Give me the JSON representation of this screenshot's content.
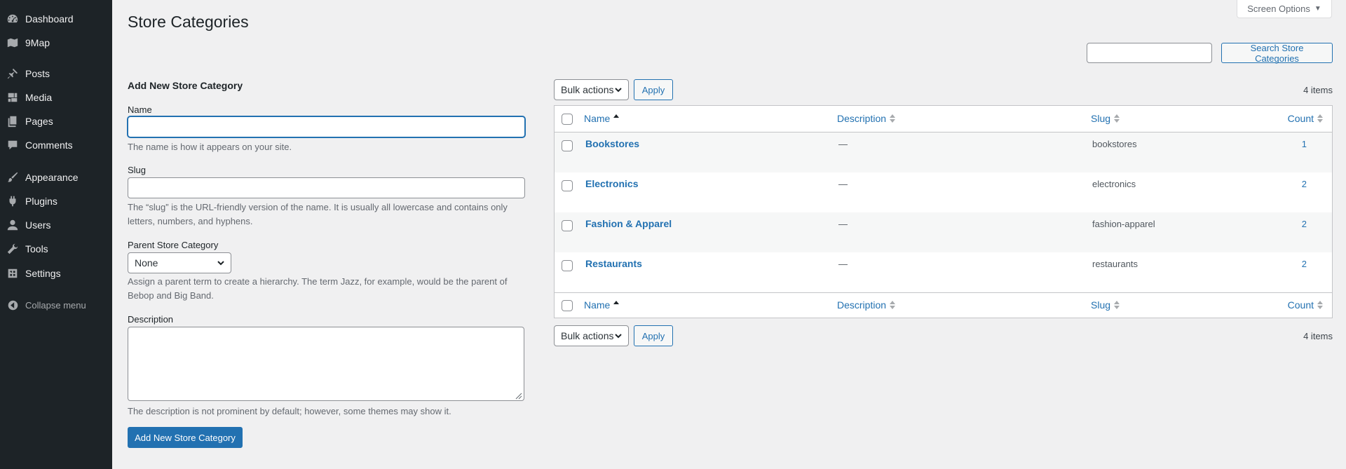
{
  "sidebar": {
    "items": [
      {
        "label": "Dashboard",
        "icon": "dashboard-icon"
      },
      {
        "label": "9Map",
        "icon": "map-icon"
      },
      {
        "label": "Posts",
        "icon": "pin-icon"
      },
      {
        "label": "Media",
        "icon": "media-icon"
      },
      {
        "label": "Pages",
        "icon": "pages-icon"
      },
      {
        "label": "Comments",
        "icon": "comments-icon"
      },
      {
        "label": "Appearance",
        "icon": "brush-icon"
      },
      {
        "label": "Plugins",
        "icon": "plugins-icon"
      },
      {
        "label": "Users",
        "icon": "users-icon"
      },
      {
        "label": "Tools",
        "icon": "wrench-icon"
      },
      {
        "label": "Settings",
        "icon": "settings-icon"
      }
    ],
    "collapse_label": "Collapse menu"
  },
  "screen_options": {
    "label": "Screen Options"
  },
  "page": {
    "title": "Store Categories"
  },
  "search": {
    "placeholder": "",
    "button_label": "Search Store Categories"
  },
  "form": {
    "heading": "Add New Store Category",
    "name_label": "Name",
    "name_value": "",
    "name_help": "The name is how it appears on your site.",
    "slug_label": "Slug",
    "slug_value": "",
    "slug_help_line1": "The “slug” is the URL-friendly version of the name. It is usually all lowercase and contains only",
    "slug_help_line2": "letters, numbers, and hyphens.",
    "parent_label": "Parent Store Category",
    "parent_value": "None",
    "parent_help_line1": "Assign a parent term to create a hierarchy. The term Jazz, for example, would be the parent of",
    "parent_help_line2": "Bebop and Big Band.",
    "description_label": "Description",
    "description_value": "",
    "description_help": "The description is not prominent by default; however, some themes may show it.",
    "submit_label": "Add New Store Category"
  },
  "table": {
    "bulk_actions_label": "Bulk actions",
    "apply_label": "Apply",
    "items_count": "4 items",
    "columns": {
      "name": "Name",
      "description": "Description",
      "slug": "Slug",
      "count": "Count"
    },
    "rows": [
      {
        "name": "Bookstores",
        "description": "—",
        "slug": "bookstores",
        "count": "1"
      },
      {
        "name": "Electronics",
        "description": "—",
        "slug": "electronics",
        "count": "2"
      },
      {
        "name": "Fashion & Apparel",
        "description": "—",
        "slug": "fashion-apparel",
        "count": "2"
      },
      {
        "name": "Restaurants",
        "description": "—",
        "slug": "restaurants",
        "count": "2"
      }
    ]
  },
  "colors": {
    "sidebar_bg": "#1d2327",
    "accent": "#2271b1",
    "page_bg": "#f0f0f1"
  }
}
